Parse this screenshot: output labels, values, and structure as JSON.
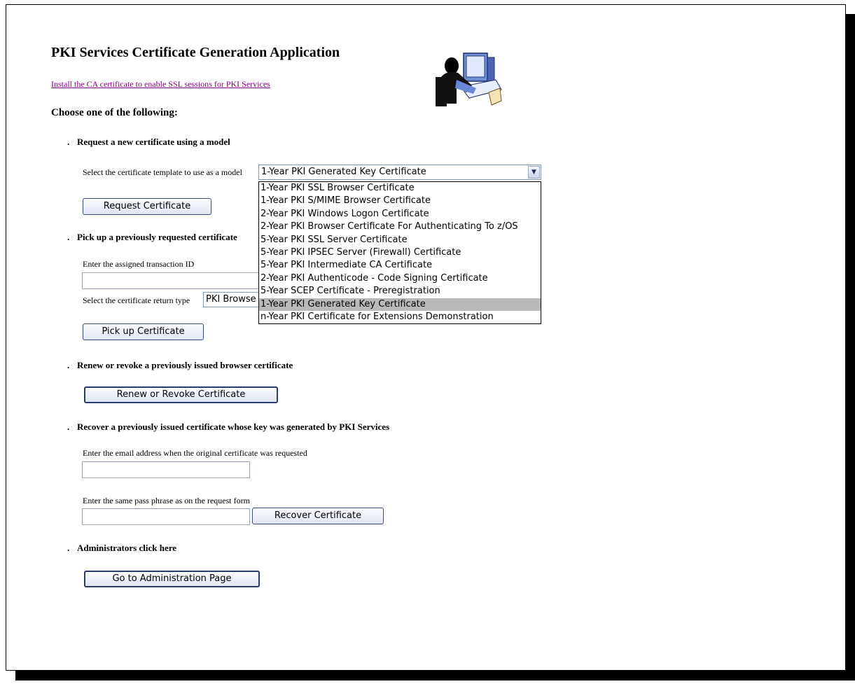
{
  "page": {
    "title": "PKI Services Certificate Generation Application",
    "ca_link": "Install the CA certificate to enable SSL sessions for PKI Services",
    "choose_heading": "Choose one of the following:"
  },
  "request": {
    "heading": "Request a new certificate using a model",
    "template_label": "Select the certificate template to use as a model",
    "selected_template": "1-Year PKI Generated Key Certificate",
    "button": "Request Certificate",
    "options": [
      "1-Year PKI SSL Browser Certificate",
      "1-Year PKI S/MIME Browser Certificate",
      "2-Year PKI Windows Logon Certificate",
      "2-Year PKI Browser Certificate For Authenticating To z/OS",
      "5-Year PKI SSL Server Certificate",
      "5-Year PKI IPSEC Server (Firewall) Certificate",
      "5-Year PKI Intermediate CA Certificate",
      "2-Year PKI Authenticode - Code Signing Certificate",
      "5-Year SCEP Certificate - Preregistration",
      "1-Year PKI Generated Key Certificate",
      "n-Year PKI Certificate for Extensions Demonstration"
    ],
    "highlighted_index": 9
  },
  "pickup": {
    "heading": "Pick up a previously requested certificate",
    "transaction_label": "Enter the assigned transaction ID",
    "transaction_value": "",
    "return_type_label": "Select the certificate return type",
    "return_type_value": "PKI Browse",
    "button": "Pick up Certificate"
  },
  "renew": {
    "heading": "Renew or revoke a previously issued browser certificate",
    "button": "Renew or Revoke Certificate"
  },
  "recover": {
    "heading": "Recover a previously issued certificate whose key was generated by PKI Services",
    "email_label": "Enter the email address when the original certificate was requested",
    "email_value": "",
    "passphrase_label": "Enter the same pass phrase as on the request form",
    "passphrase_value": "",
    "button": "Recover Certificate"
  },
  "admin": {
    "heading": "Administrators click here",
    "button": "Go to Administration Page"
  },
  "bullet_glyph": ".",
  "icons": {
    "illustration": "person-at-computer-icon",
    "dropdown_arrow": "chevron-down-icon"
  }
}
